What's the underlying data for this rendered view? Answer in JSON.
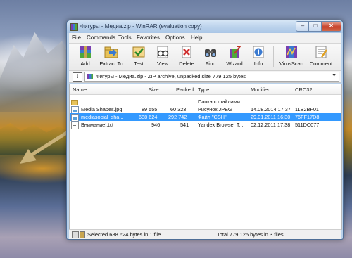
{
  "window": {
    "title": "Фигуры - Медиа.zip - WinRAR (evaluation copy)",
    "controls": {
      "minimize": "–",
      "maximize": "□",
      "close": "✕"
    }
  },
  "menu": [
    "File",
    "Commands",
    "Tools",
    "Favorites",
    "Options",
    "Help"
  ],
  "toolbar": {
    "add": "Add",
    "extract": "Extract To",
    "test": "Test",
    "view": "View",
    "delete": "Delete",
    "find": "Find",
    "wizard": "Wizard",
    "info": "Info",
    "virusscan": "VirusScan",
    "comment": "Comment"
  },
  "address": {
    "up": "⇧",
    "path": "Фигуры - Медиа.zip - ZIP archive, unpacked size 779 125 bytes",
    "dropdown": "▼"
  },
  "columns": {
    "name": "Name",
    "size": "Size",
    "packed": "Packed",
    "type": "Type",
    "modified": "Modified",
    "crc": "CRC32"
  },
  "files": [
    {
      "name": "..",
      "size": "",
      "packed": "",
      "type": "Папка с файлами",
      "modified": "",
      "crc": ""
    },
    {
      "name": "Media Shapes.jpg",
      "size": "89 555",
      "packed": "60 323",
      "type": "Рисунок JPEG",
      "modified": "14.08.2014 17:37",
      "crc": "11B2BF01"
    },
    {
      "name": "mediasocial_sha...",
      "size": "688 624",
      "packed": "292 742",
      "type": "Файл \"CSH\"",
      "modified": "29.01.2011 16:30",
      "crc": "76FF17D8"
    },
    {
      "name": "Внимание!.txt",
      "size": "946",
      "packed": "541",
      "type": "Yandex Browser T...",
      "modified": "02.12.2011 17:38",
      "crc": "511DC077"
    }
  ],
  "status": {
    "left": "Selected 688 624 bytes in 1 file",
    "right": "Total 779 125 bytes in 3 files"
  },
  "colors": {
    "selection": "#3399ff",
    "arrow": "#c9b27a"
  }
}
